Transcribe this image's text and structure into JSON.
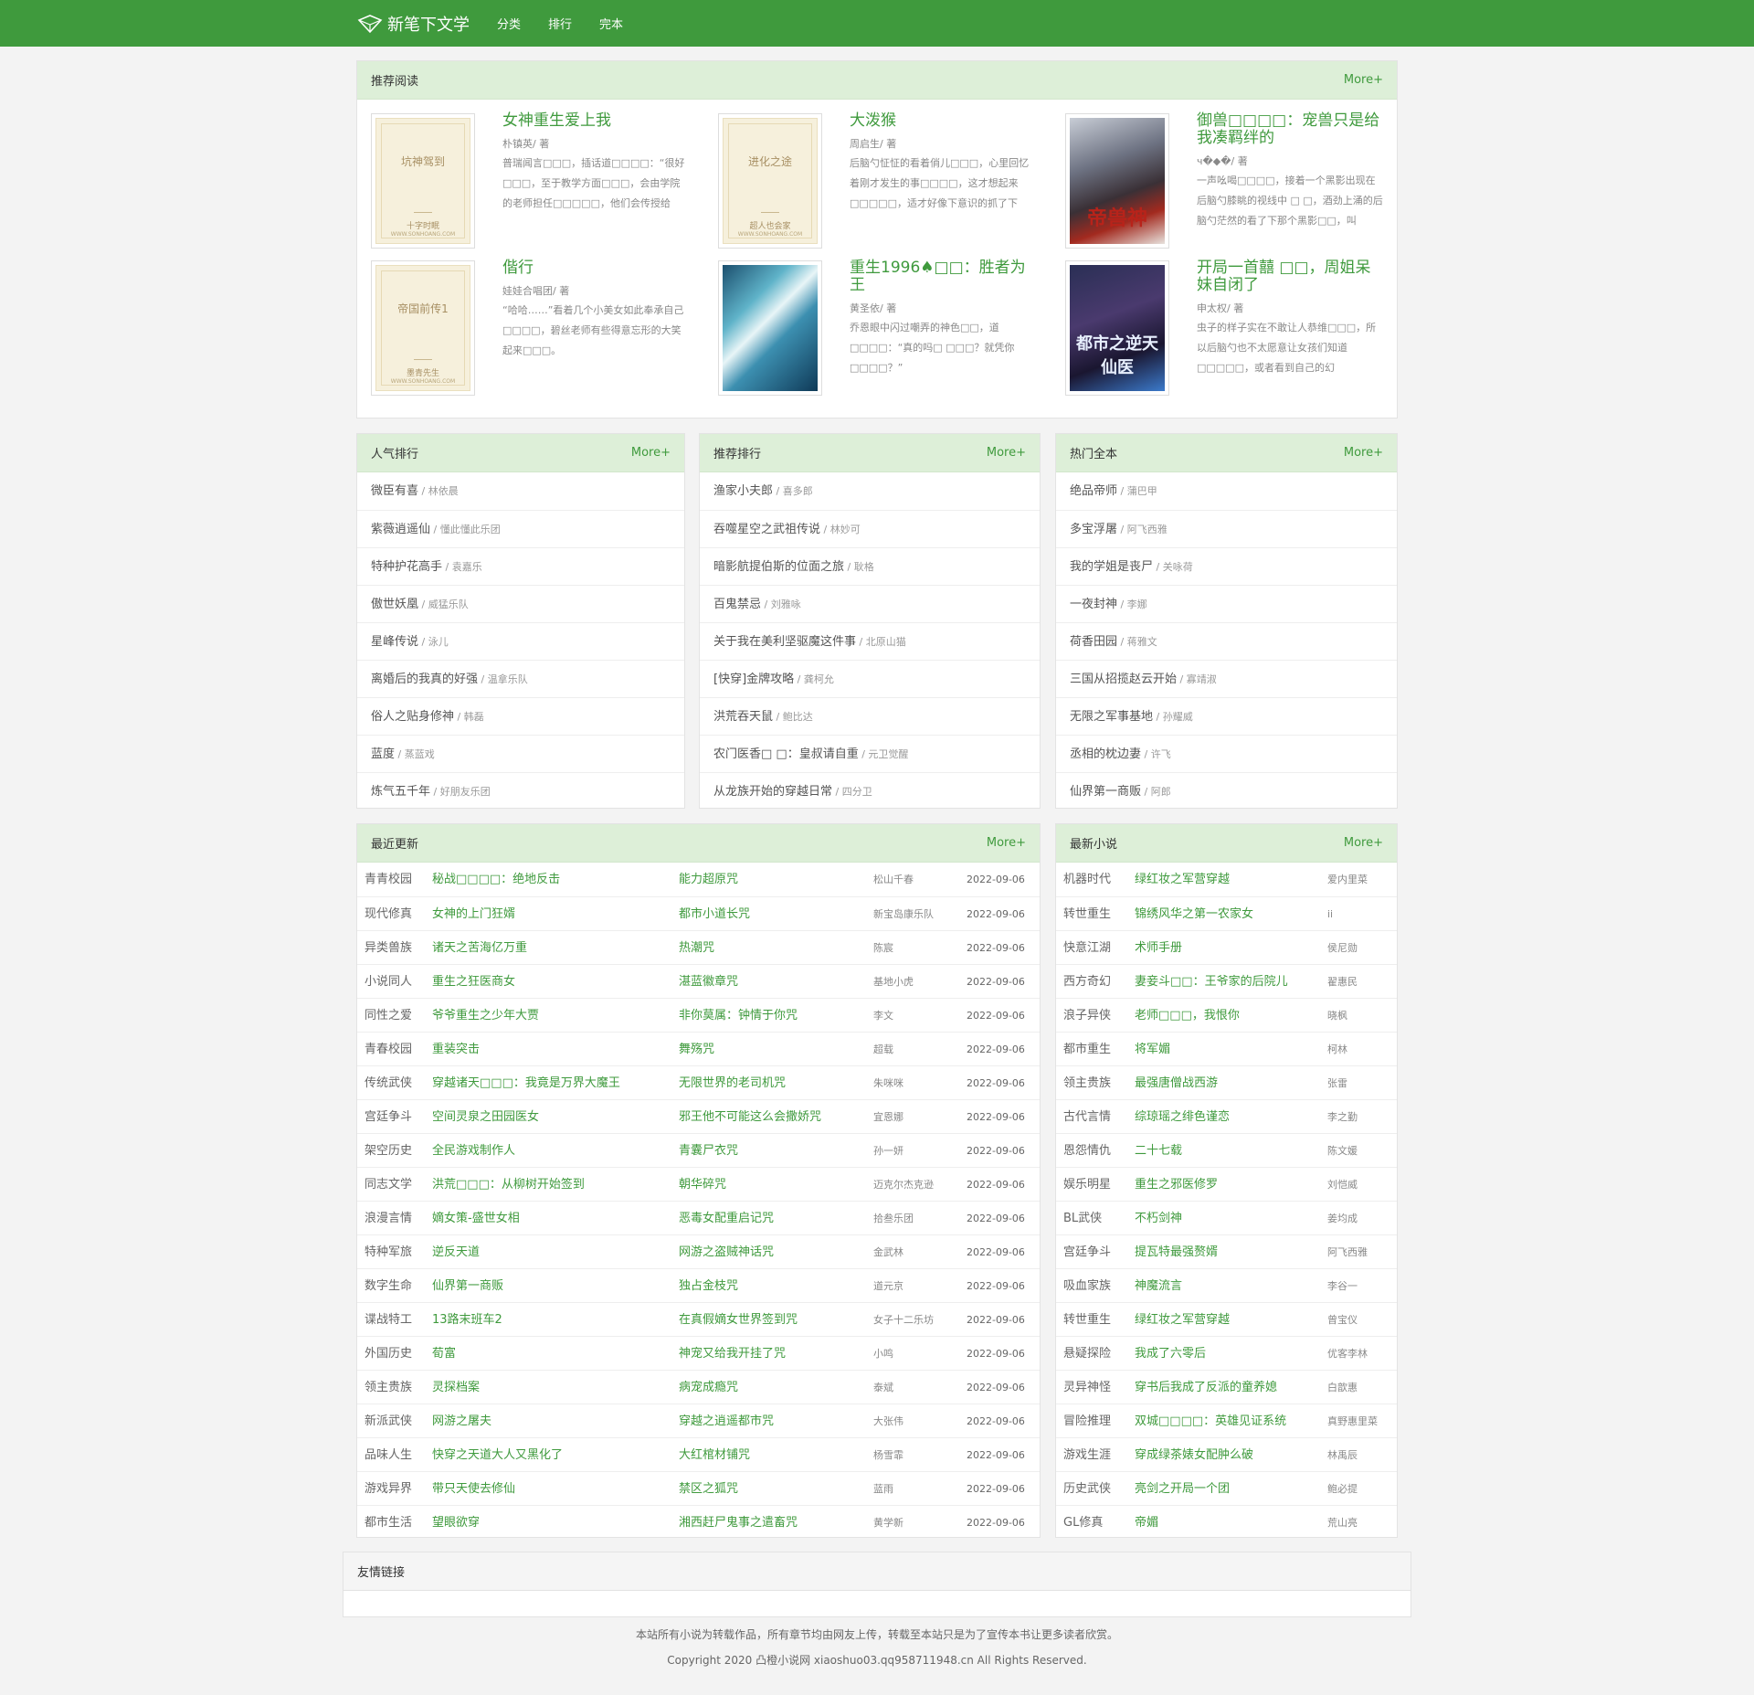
{
  "nav": {
    "logo": "新笔下文学",
    "links": [
      "分类",
      "排行",
      "完本"
    ]
  },
  "colors": {
    "brand": "#3f9a3d",
    "panel_header": "#ddefd8"
  },
  "recommend": {
    "title": "推荐阅读",
    "more": "More+",
    "books": [
      {
        "title": "女神重生爱上我",
        "author": "朴镇英/ 著",
        "desc": "普瑞闻言□□□，插话道□□□□：“很好□□□，至于教学方面□□□，会由学院的老师担任□□□□□，他们会传授给",
        "cover_title": "坑神驾到",
        "cover_author": "十字时眠",
        "cover_site": "WWW.SONHOANG.COM"
      },
      {
        "title": "大泼猴",
        "author": "周启生/ 著",
        "desc": "后脑勺怔怔的看着俏儿□□□，心里回忆着刚才发生的事□□□□，这才想起来□□□□□，适才好像下意识的抓了下",
        "cover_title": "进化之途",
        "cover_author": "超人也会家",
        "cover_site": "WWW.SONHOANG.COM"
      },
      {
        "title": "御兽□□□□：宠兽只是给我凑羁绊的",
        "author": "ч�◆�/ 著",
        "desc": "一声吆喝□□□□，接着一个黑影出现在后脑勺膝眺的视线中 □ □，酒劲上涌的后脑勺茫然的看了下那个黑影□□，叫",
        "cover_text": "帝兽神"
      },
      {
        "title": "偕行",
        "author": "娃娃合唱团/ 著",
        "desc": "“哈哈……”看着几个小美女如此奉承自己 □□□□，碧丝老师有些得意忘形的大笑起来□□□。",
        "cover_title": "帝国前传1",
        "cover_author": "墨青先生",
        "cover_site": "WWW.SONHOANG.COM"
      },
      {
        "title": "重生1996♠□□：胜者为王",
        "author": "黄圣依/ 著",
        "desc": "乔恩眼中闪过嘲弄的神色□□，道□□□□：“真的吗□ □□□？就凭你□□□□？”",
        "cover_text": ""
      },
      {
        "title": "开局一首囍 □□，周姐呆妹自闭了",
        "author": "申太权/ 著",
        "desc": "虫子的样子实在不敢让人恭维□□□，所以后脑勺也不太愿意让女孩们知道□□□□□，或者看到自己的幻",
        "cover_text": "都市之逆天仙医"
      }
    ]
  },
  "rank_popular": {
    "title": "人气排行",
    "more": "More+",
    "items": [
      {
        "t": "微臣有喜",
        "a": " / 林依晨"
      },
      {
        "t": "紫薇逍遥仙",
        "a": " / 懂此懂此乐团"
      },
      {
        "t": "特种护花高手",
        "a": " / 袁嘉乐"
      },
      {
        "t": "傲世妖凰",
        "a": " / 威猛乐队"
      },
      {
        "t": "星峰传说",
        "a": " / 泳儿"
      },
      {
        "t": "离婚后的我真的好强",
        "a": " / 温拿乐队"
      },
      {
        "t": "俗人之贴身修神",
        "a": " / 韩磊"
      },
      {
        "t": "蓝度",
        "a": " / 蒸蓝戏"
      },
      {
        "t": "炼气五千年",
        "a": " / 好朋友乐团"
      }
    ]
  },
  "rank_recommend": {
    "title": "推荐排行",
    "more": "More+",
    "items": [
      {
        "t": "渔家小夫郎",
        "a": " / 喜多郎"
      },
      {
        "t": "吞噬星空之武祖传说",
        "a": " / 林妙可"
      },
      {
        "t": "暗影航提伯斯的位面之旅",
        "a": " / 耿格"
      },
      {
        "t": "百鬼禁忌",
        "a": " / 刘雅咏"
      },
      {
        "t": "关于我在美利坚驱魔这件事",
        "a": " / 北原山猫"
      },
      {
        "t": "[快穿]金牌攻略",
        "a": " / 龚柯允"
      },
      {
        "t": "洪荒吞天鼠",
        "a": " / 鲍比达"
      },
      {
        "t": "农门医香□ □：皇叔请自重",
        "a": " / 元卫觉醒"
      },
      {
        "t": "从龙族开始的穿越日常",
        "a": " / 四分卫"
      }
    ]
  },
  "hot_complete": {
    "title": "热门全本",
    "more": "More+",
    "items": [
      {
        "t": "绝品帝师",
        "a": " / 蒲巴甲"
      },
      {
        "t": "多宝浮屠",
        "a": " / 阿飞西雅"
      },
      {
        "t": "我的学姐是丧尸",
        "a": " / 关咏荷"
      },
      {
        "t": "一夜封神",
        "a": " / 李娜"
      },
      {
        "t": "荷香田园",
        "a": " / 蒋雅文"
      },
      {
        "t": "三国从招揽赵云开始",
        "a": " / 寡靖淑"
      },
      {
        "t": "无限之军事基地",
        "a": " / 孙耀威"
      },
      {
        "t": "丞相的枕边妻",
        "a": " / 许飞"
      },
      {
        "t": "仙界第一商贩",
        "a": " / 阿郎"
      }
    ]
  },
  "recent": {
    "title": "最近更新",
    "more": "More+",
    "rows": [
      {
        "cat": "青青校园",
        "title": "秘战□□□□：绝地反击",
        "chap": "能力超原咒",
        "author": "松山千春",
        "date": "2022-09-06"
      },
      {
        "cat": "现代修真",
        "title": "女神的上门狂婿",
        "chap": "都市小道长咒",
        "author": "新宝岛康乐队",
        "date": "2022-09-06"
      },
      {
        "cat": "异类兽族",
        "title": "诸天之苦海亿万重",
        "chap": "热潮咒",
        "author": "陈宸",
        "date": "2022-09-06"
      },
      {
        "cat": "小说同人",
        "title": "重生之狂医商女",
        "chap": "湛蓝徽章咒",
        "author": "基地小虎",
        "date": "2022-09-06"
      },
      {
        "cat": "同性之爱",
        "title": "爷爷重生之少年大贾",
        "chap": "非你莫属：钟情于你咒",
        "author": "李文",
        "date": "2022-09-06"
      },
      {
        "cat": "青春校园",
        "title": "重装突击",
        "chap": "舞殇咒",
        "author": "超载",
        "date": "2022-09-06"
      },
      {
        "cat": "传统武侠",
        "title": "穿越诸天□□□：我竟是万界大魔王",
        "chap": "无限世界的老司机咒",
        "author": "朱咪咪",
        "date": "2022-09-06"
      },
      {
        "cat": "宫廷争斗",
        "title": "空间灵泉之田园医女",
        "chap": "邪王他不可能这么会撒娇咒",
        "author": "宜恩娜",
        "date": "2022-09-06"
      },
      {
        "cat": "架空历史",
        "title": "全民游戏制作人",
        "chap": "青囊尸衣咒",
        "author": "孙一妍",
        "date": "2022-09-06"
      },
      {
        "cat": "同志文学",
        "title": "洪荒□□□：从柳树开始签到",
        "chap": "朝华碎咒",
        "author": "迈克尔杰克逊",
        "date": "2022-09-06"
      },
      {
        "cat": "浪漫言情",
        "title": "嫡女策-盛世女相",
        "chap": "恶毒女配重启记咒",
        "author": "拾叁乐团",
        "date": "2022-09-06"
      },
      {
        "cat": "特种军旅",
        "title": "逆反天道",
        "chap": "网游之盗贼神话咒",
        "author": "金武林",
        "date": "2022-09-06"
      },
      {
        "cat": "数字生命",
        "title": "仙界第一商贩",
        "chap": "独占金枝咒",
        "author": "道元京",
        "date": "2022-09-06"
      },
      {
        "cat": "谍战特工",
        "title": "13路末班车2",
        "chap": "在真假嫡女世界签到咒",
        "author": "女子十二乐坊",
        "date": "2022-09-06"
      },
      {
        "cat": "外国历史",
        "title": "荀富",
        "chap": "神宠又给我开挂了咒",
        "author": "小鸣",
        "date": "2022-09-06"
      },
      {
        "cat": "领主贵族",
        "title": "灵探档案",
        "chap": "病宠成瘾咒",
        "author": "泰斌",
        "date": "2022-09-06"
      },
      {
        "cat": "新派武侠",
        "title": "网游之屠夫",
        "chap": "穿越之逍遥都市咒",
        "author": "大张伟",
        "date": "2022-09-06"
      },
      {
        "cat": "品味人生",
        "title": "快穿之天道大人又黑化了",
        "chap": "大红棺材铺咒",
        "author": "杨雪霏",
        "date": "2022-09-06"
      },
      {
        "cat": "游戏异界",
        "title": "带只天使去修仙",
        "chap": "禁区之狐咒",
        "author": "蓝雨",
        "date": "2022-09-06"
      },
      {
        "cat": "都市生活",
        "title": "望眼欲穿",
        "chap": "湘西赶尸鬼事之遣畜咒",
        "author": "黄学新",
        "date": "2022-09-06"
      }
    ]
  },
  "newest": {
    "title": "最新小说",
    "more": "More+",
    "rows": [
      {
        "cat": "机器时代",
        "title": "绿红妆之军营穿越",
        "author": "爱内里菜"
      },
      {
        "cat": "转世重生",
        "title": "锦绣风华之第一农家女",
        "author": "ii"
      },
      {
        "cat": "快意江湖",
        "title": "术师手册",
        "author": "侯尼勋"
      },
      {
        "cat": "西方奇幻",
        "title": "妻妾斗□□：王爷家的后院儿",
        "author": "翟惠民"
      },
      {
        "cat": "浪子异侠",
        "title": "老师□□□，我恨你",
        "author": "晓枫"
      },
      {
        "cat": "都市重生",
        "title": "将军媚",
        "author": "柯林"
      },
      {
        "cat": "领主贵族",
        "title": "最强唐僧战西游",
        "author": "张雷"
      },
      {
        "cat": "古代言情",
        "title": "综琼瑶之绯色谨恋",
        "author": "李之勤"
      },
      {
        "cat": "恩怨情仇",
        "title": "二十七载",
        "author": "陈文媛"
      },
      {
        "cat": "娱乐明星",
        "title": "重生之邪医修罗",
        "author": "刘恺威"
      },
      {
        "cat": "BL武侠",
        "title": "不朽剑神",
        "author": "姜均成"
      },
      {
        "cat": "宫廷争斗",
        "title": "提瓦特最强赘婿",
        "author": "阿飞西雅"
      },
      {
        "cat": "吸血家族",
        "title": "神魔流言",
        "author": "李谷一"
      },
      {
        "cat": "转世重生",
        "title": "绿红妆之军营穿越",
        "author": "曾宝仪"
      },
      {
        "cat": "悬疑探险",
        "title": "我成了六零后",
        "author": "优客李林"
      },
      {
        "cat": "灵异神怪",
        "title": "穿书后我成了反派的童养媳",
        "author": "白歆惠"
      },
      {
        "cat": "冒险推理",
        "title": "双城□□□□：英雄见证系统",
        "author": "真野惠里菜"
      },
      {
        "cat": "游戏生涯",
        "title": "穿成绿茶婊女配肿么破",
        "author": "林禹辰"
      },
      {
        "cat": "历史武侠",
        "title": "亮剑之开局一个团",
        "author": "鲍必提"
      },
      {
        "cat": "GL修真",
        "title": "帝媚",
        "author": "荒山亮"
      }
    ]
  },
  "friendlinks": {
    "title": "友情链接"
  },
  "footer": {
    "line1": "本站所有小说为转载作品，所有章节均由网友上传，转载至本站只是为了宣传本书让更多读者欣赏。",
    "line2": "Copyright 2020 凸橙小说网 xiaoshuo03.qq958711948.cn All Rights Reserved."
  }
}
